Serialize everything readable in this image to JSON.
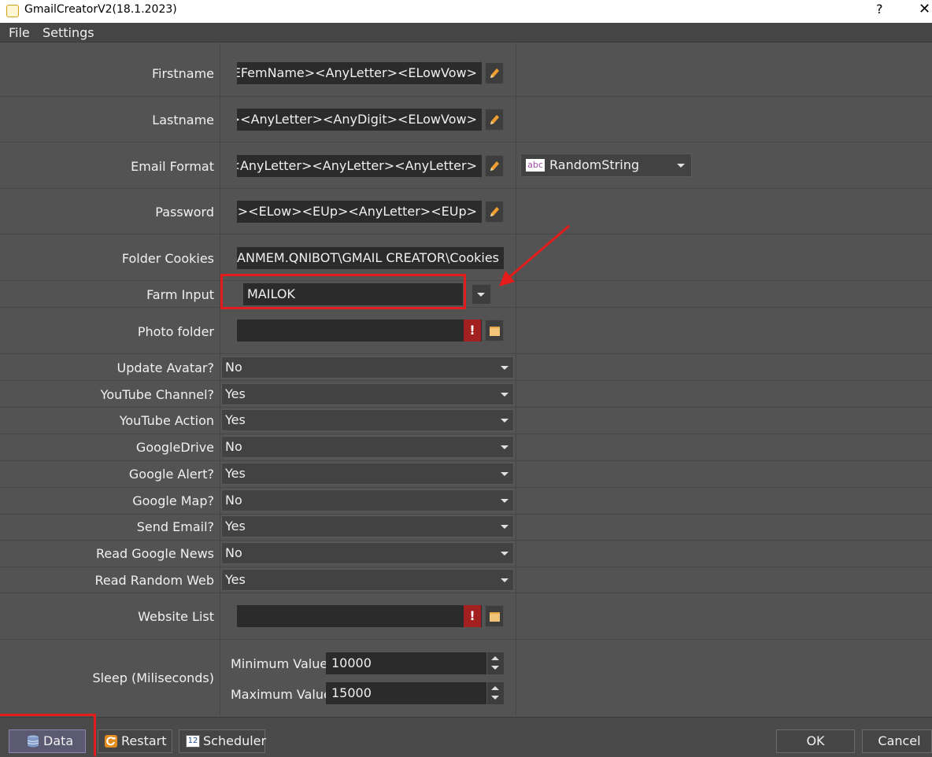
{
  "window": {
    "title": "GmailCreatorV2(18.1.2023)",
    "help": "?",
    "close": "✕"
  },
  "menu": {
    "file": "File",
    "settings": "Settings"
  },
  "fields": {
    "firstname": {
      "label": "Firstname",
      "value": "<EFemName><AnyLetter><ELowVow>"
    },
    "lastname": {
      "label": "Lastname",
      "value": "ame><AnyLetter><AnyDigit><ELowVow>"
    },
    "email_format": {
      "label": "Email Format",
      "value": "ow><AnyLetter><AnyLetter><AnyLetter>",
      "type_option": "RandomString",
      "type_icon": "abc"
    },
    "password": {
      "label": "Password",
      "value": "nbers><ELow><EUp><AnyLetter><EUp>"
    },
    "folder_cookies": {
      "label": "Folder Cookies",
      "value": "..PHANMEM.QNIBOT\\GMAIL CREATOR\\Cookies"
    },
    "farm_input": {
      "label": "Farm Input",
      "value": "MAILOK"
    },
    "photo_folder": {
      "label": "Photo folder",
      "value": "",
      "warning": "!"
    },
    "website_list": {
      "label": "Website List",
      "value": "",
      "warning": "!"
    }
  },
  "dropdowns": [
    {
      "label": "Update Avatar?",
      "value": "No"
    },
    {
      "label": "YouTube Channel?",
      "value": "Yes"
    },
    {
      "label": "YouTube Action",
      "value": "Yes"
    },
    {
      "label": "GoogleDrive",
      "value": "No"
    },
    {
      "label": "Google Alert?",
      "value": "Yes"
    },
    {
      "label": "Google Map?",
      "value": "No"
    },
    {
      "label": "Send Email?",
      "value": "Yes"
    },
    {
      "label": "Read Google News",
      "value": "No"
    },
    {
      "label": "Read Random Web",
      "value": "Yes"
    }
  ],
  "sleep": {
    "label": "Sleep (Miliseconds)",
    "min_label": "Minimum Value",
    "min_value": "10000",
    "max_label": "Maximum Value",
    "max_value": "15000"
  },
  "buttons": {
    "data": "Data",
    "restart": "Restart",
    "scheduler": "Scheduler",
    "scheduler_icon": "12",
    "ok": "OK",
    "cancel": "Cancel"
  },
  "colors": {
    "annotation": "#e51c1c",
    "warning": "#a22020",
    "background": "#535353",
    "input": "#2b2b2b"
  }
}
